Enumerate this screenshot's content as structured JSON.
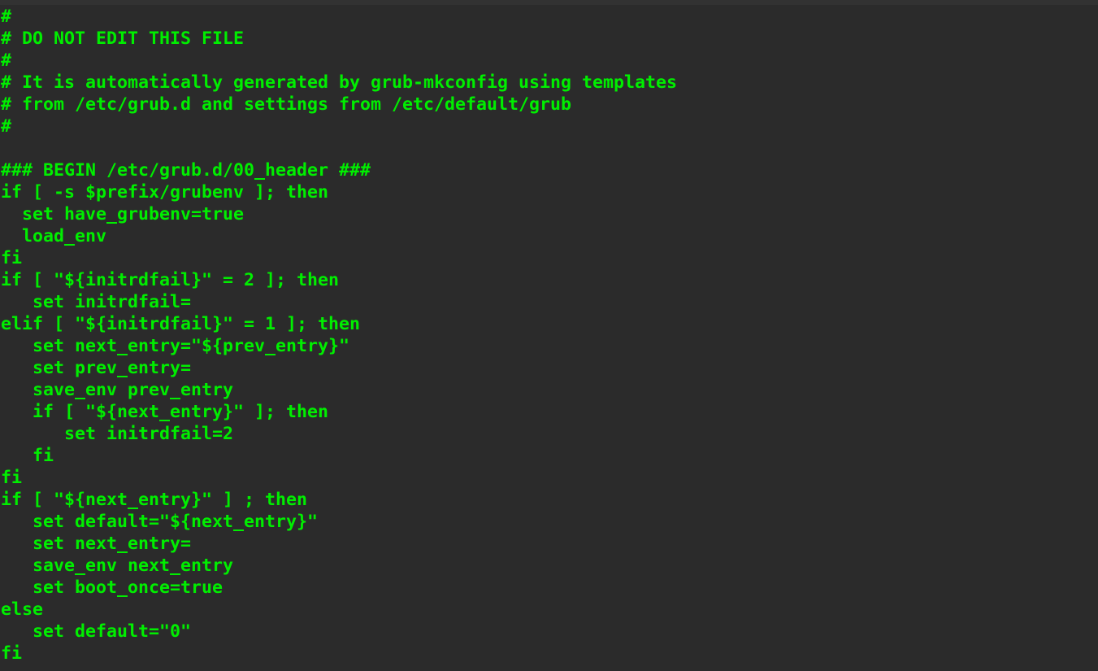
{
  "editor": {
    "text_color": "#00ee00",
    "background": "#2b2b2b",
    "lines": [
      "#",
      "# DO NOT EDIT THIS FILE",
      "#",
      "# It is automatically generated by grub-mkconfig using templates",
      "# from /etc/grub.d and settings from /etc/default/grub",
      "#",
      "",
      "### BEGIN /etc/grub.d/00_header ###",
      "if [ -s $prefix/grubenv ]; then",
      "  set have_grubenv=true",
      "  load_env",
      "fi",
      "if [ \"${initrdfail}\" = 2 ]; then",
      "   set initrdfail=",
      "elif [ \"${initrdfail}\" = 1 ]; then",
      "   set next_entry=\"${prev_entry}\"",
      "   set prev_entry=",
      "   save_env prev_entry",
      "   if [ \"${next_entry}\" ]; then",
      "      set initrdfail=2",
      "   fi",
      "fi",
      "if [ \"${next_entry}\" ] ; then",
      "   set default=\"${next_entry}\"",
      "   set next_entry=",
      "   save_env next_entry",
      "   set boot_once=true",
      "else",
      "   set default=\"0\"",
      "fi"
    ]
  }
}
